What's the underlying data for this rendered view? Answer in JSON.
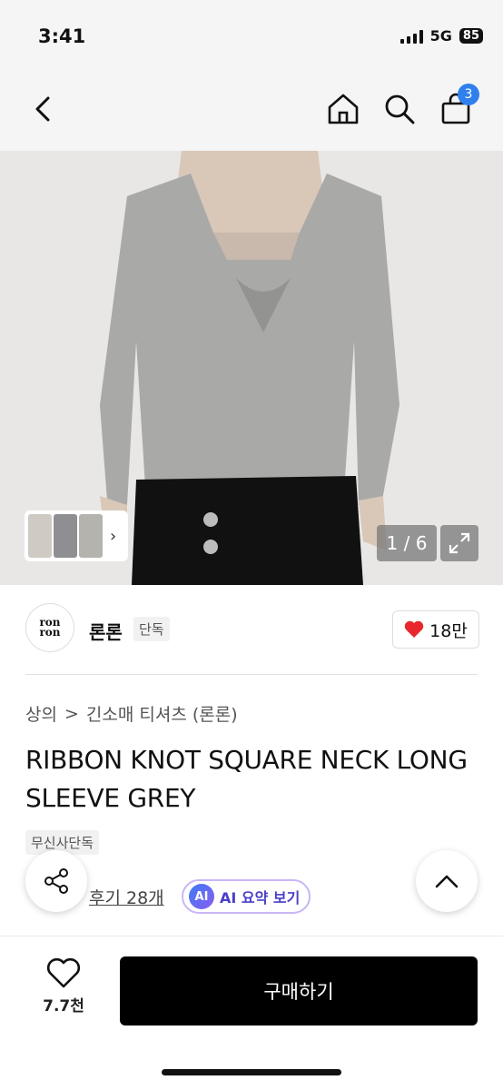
{
  "status_bar": {
    "time": "3:41",
    "network": "5G",
    "battery": "85"
  },
  "nav": {
    "cart_count": "3"
  },
  "gallery": {
    "counter": "1 / 6"
  },
  "brand": {
    "logo_text_1": "ron",
    "logo_text_2": "ron",
    "name": "론론",
    "tag": "단독"
  },
  "like": {
    "count": "18만"
  },
  "breadcrumb": {
    "category": "상의",
    "separator": ">",
    "subcategory": "긴소매 티셔츠 (론론)"
  },
  "product": {
    "title": "RIBBON KNOT SQUARE NECK LONG SLEEVE GREY",
    "badge": "무신사단독"
  },
  "review": {
    "link_text": "후기 28개",
    "ai_chip": "AI",
    "ai_label": "AI 요약 보기"
  },
  "bottom_bar": {
    "wish_count": "7.7천",
    "buy_label": "구매하기"
  },
  "colors": {
    "accent": "#2f80ed",
    "heart": "#e8262c",
    "buy_bg": "#000000"
  },
  "icons": [
    "back-icon",
    "home-icon",
    "search-icon",
    "cart-icon",
    "expand-icon",
    "heart-icon",
    "share-icon",
    "chevron-up-icon",
    "chevron-right-icon"
  ]
}
